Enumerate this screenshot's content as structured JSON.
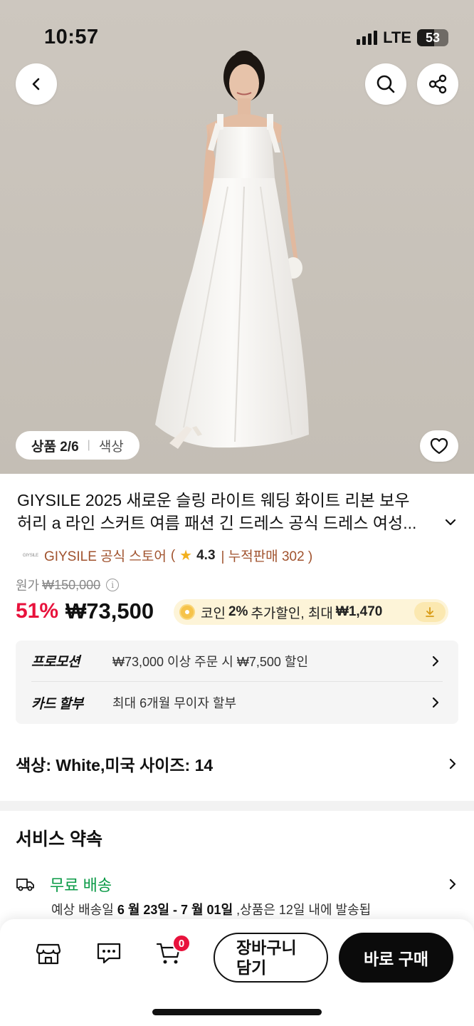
{
  "status_bar": {
    "time": "10:57",
    "network": "LTE",
    "battery": "53"
  },
  "gallery": {
    "counter": "상품 2/6",
    "attribute_tab": "색상",
    "icons": {
      "back": "chevron-left-icon",
      "search": "search-icon",
      "share": "share-icon",
      "favorite": "heart-icon"
    }
  },
  "product": {
    "title_line1": "GIYSILE 2025 새로운 슬링 라이트 웨딩 화이트 리본 보우",
    "title_line2": "허리 a 라인 스커트 여름 패션 긴 드레스 공식 드레스 여성..."
  },
  "store": {
    "logo_text": "GIYSILE",
    "name": "GIYSILE 공식 스토어",
    "open_paren": "(",
    "rating": "4.3",
    "sales": "| 누적판매 302 )"
  },
  "pricing": {
    "original_label": "원가",
    "original_price": "₩150,000",
    "discount": "51%",
    "price": "₩73,500",
    "coin_prefix": "코인",
    "coin_percent": "2%",
    "coin_middle": "추가할인, 최대",
    "coin_max": "₩1,470"
  },
  "promotions": [
    {
      "label": "프로모션",
      "text": "₩73,000 이상 주문 시 ₩7,500 할인"
    },
    {
      "label": "카드 할부",
      "text": "최대 6개월 무이자 할부"
    }
  ],
  "option": {
    "text": "색상: White,미국 사이즈: 14"
  },
  "service": {
    "title": "서비스 약속",
    "shipping_label": "무료 배송",
    "delivery_prefix": "예상 배송일",
    "delivery_dates": "6 월 23일 - 7 월 01일",
    "delivery_suffix": ",상품은 12일 내에 발송됩"
  },
  "bottom_bar": {
    "cart_count": "0",
    "add_to_cart_line1": "장바구니",
    "add_to_cart_line2": "담기",
    "buy_now": "바로 구매"
  },
  "colors": {
    "accent_red": "#e8123c",
    "shipping_green": "#0a9a46",
    "store_brown": "#a0522d",
    "coin_bg": "#fdf4d8",
    "hero_bg": "#c9c3bb"
  }
}
